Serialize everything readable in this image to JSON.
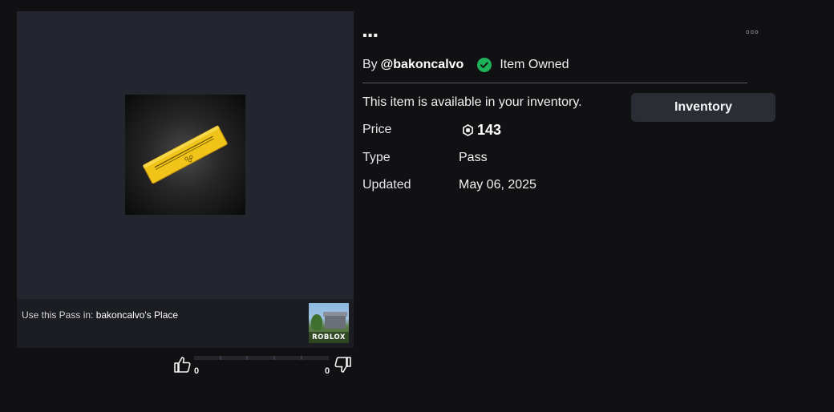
{
  "item": {
    "title": "▪▪▪",
    "more_menu": "▫▫▫",
    "by_prefix": "By",
    "creator": "@bakoncalvo",
    "owned_label": "Item Owned",
    "availability": "This item is available in your inventory.",
    "inventory_button": "Inventory",
    "details": {
      "price_label": "Price",
      "price_value": "143",
      "type_label": "Type",
      "type_value": "Pass",
      "updated_label": "Updated",
      "updated_value": "May 06, 2025"
    }
  },
  "thumbnail": {
    "use_pass_prefix": "Use this Pass in: ",
    "place_name": "bakoncalvo's Place",
    "place_logo": "ROBLOX"
  },
  "votes": {
    "up_count": "0",
    "down_count": "0"
  },
  "icons": {
    "owned": "check-circle-icon",
    "currency": "robux-icon",
    "upvote": "thumbs-up-icon",
    "downvote": "thumbs-down-icon"
  },
  "colors": {
    "background": "#111114",
    "card": "#23262e",
    "owned_green": "#1fb05a",
    "pass_gold": "#f0c419",
    "button": "#2b2d35"
  }
}
